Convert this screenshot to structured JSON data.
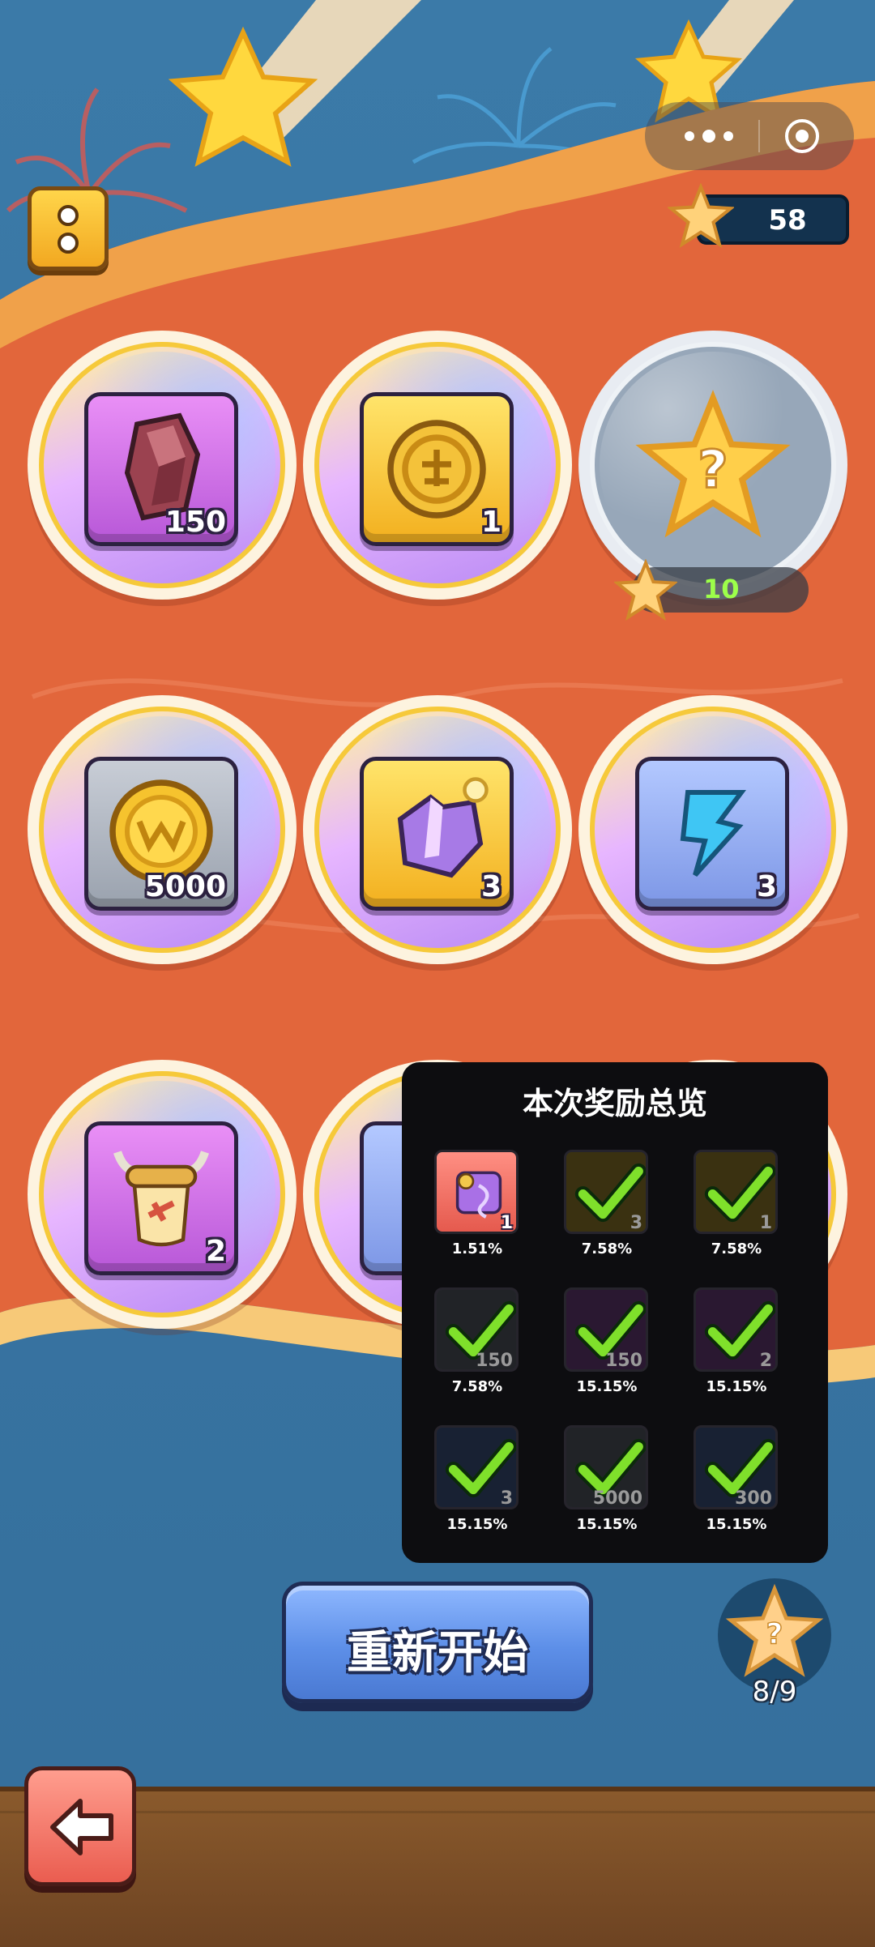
{
  "hud": {
    "star_balance": "58"
  },
  "rewards": {
    "row1": [
      {
        "icon": "ore-rock-icon",
        "qty": "150"
      },
      {
        "icon": "gold-medal-coin-icon",
        "qty": "1"
      },
      {
        "icon": "mystery-star-icon",
        "cost": "10"
      }
    ],
    "row2": [
      {
        "icon": "coin-icon",
        "qty": "5000"
      },
      {
        "icon": "armor-shard-icon",
        "qty": "3"
      },
      {
        "icon": "lightning-energy-icon",
        "qty": "3"
      }
    ],
    "row3": [
      {
        "icon": "horned-scroll-icon",
        "qty": "2"
      }
    ]
  },
  "overview": {
    "title": "本次奖励总览",
    "items": [
      {
        "icon": "scroll-icon",
        "qty": "1",
        "pct": "1.51%",
        "collected": false
      },
      {
        "icon": "armor-shard-icon",
        "qty": "3",
        "pct": "7.58%",
        "collected": true
      },
      {
        "icon": "gold-medal-coin-icon",
        "qty": "1",
        "pct": "7.58%",
        "collected": true
      },
      {
        "icon": "ore-rock-icon",
        "qty": "150",
        "pct": "7.58%",
        "collected": true
      },
      {
        "icon": "ore-rock-icon",
        "qty": "150",
        "pct": "15.15%",
        "collected": true
      },
      {
        "icon": "horned-scroll-icon",
        "qty": "2",
        "pct": "15.15%",
        "collected": true
      },
      {
        "icon": "lightning-energy-icon",
        "qty": "3",
        "pct": "15.15%",
        "collected": true
      },
      {
        "icon": "coin-icon",
        "qty": "5000",
        "pct": "15.15%",
        "collected": true
      },
      {
        "icon": "boot-icon",
        "qty": "300",
        "pct": "15.15%",
        "collected": true
      }
    ]
  },
  "controls": {
    "restart_label": "重新开始",
    "progress": "8/9"
  },
  "colors": {
    "accent_red": "#ea5d50",
    "button_blue": "#5d8fe8",
    "highlight_green": "#9dff4a",
    "tile_gold": "#f3b01f",
    "tile_purple": "#b858d8"
  }
}
